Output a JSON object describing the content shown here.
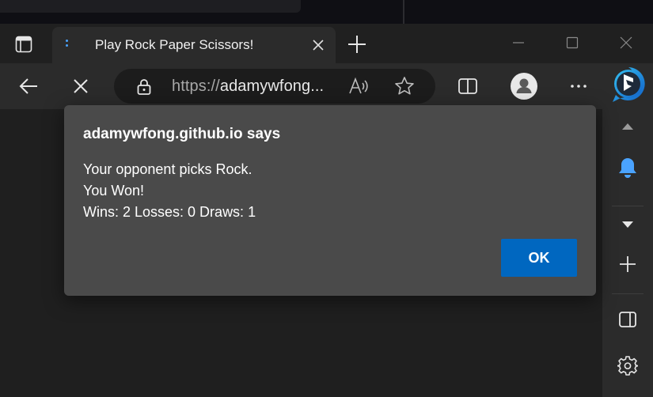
{
  "tab": {
    "title": "Play Rock Paper Scissors!"
  },
  "addressbar": {
    "protocol": "https://",
    "host": "adamywfong..."
  },
  "dialog": {
    "header": "adamywfong.github.io says",
    "lines": [
      "Your opponent picks Rock.",
      "You Won!",
      "Wins: 2 Losses: 0 Draws: 1"
    ],
    "ok_label": "OK"
  },
  "icons": {
    "tab_actions": "tab-actions-icon",
    "favicon": "loading-favicon",
    "tab_close": "close-icon",
    "new_tab": "plus-icon",
    "minimize": "minimize-icon",
    "maximize": "maximize-icon",
    "window_close": "close-icon",
    "back": "back-arrow-icon",
    "stop": "stop-icon",
    "lock": "lock-icon",
    "read_aloud": "read-aloud-icon",
    "favorite": "star-icon",
    "split_screen": "split-screen-icon",
    "profile": "profile-icon",
    "more": "more-icon",
    "bing": "bing-icon",
    "sidebar_up": "chevron-up-icon",
    "notifications": "bell-icon",
    "sidebar_down": "chevron-down-icon",
    "sidebar_add": "plus-icon",
    "sidebar_layout": "sidebar-layout-icon",
    "settings": "gear-icon"
  },
  "colors": {
    "accent": "#0067c0",
    "dialog_bg": "#4a4a4a",
    "bell": "#4aa3ff"
  }
}
